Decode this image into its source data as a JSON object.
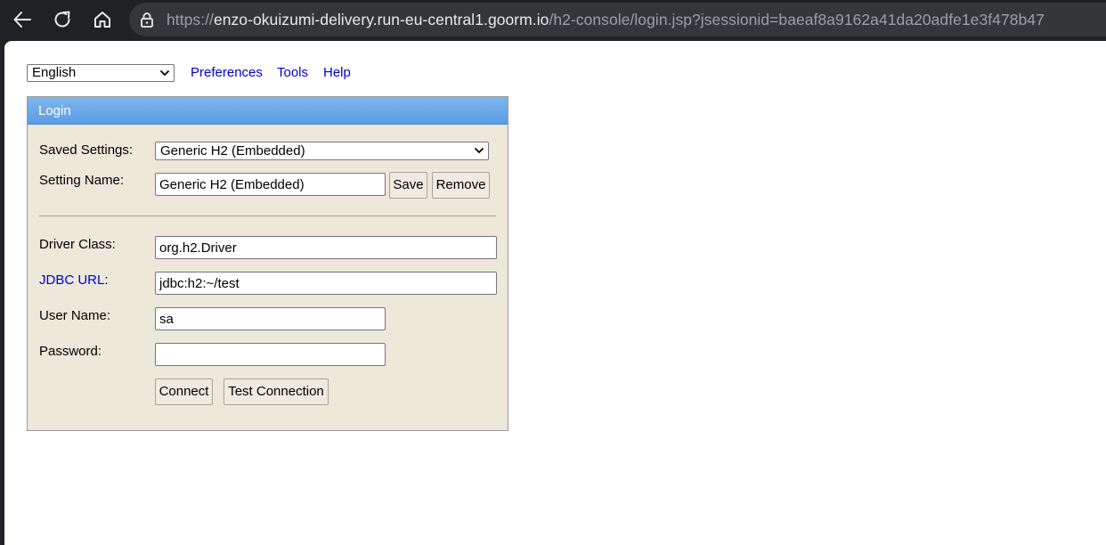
{
  "browser": {
    "url_scheme": "https://",
    "url_host": "enzo-okuizumi-delivery.run-eu-central1.goorm.io",
    "url_path": "/h2-console/login.jsp?jsessionid=baeaf8a9162a41da20adfe1e3f478b47",
    "icons": [
      "back-icon",
      "reload-icon",
      "home-icon",
      "lock-icon"
    ]
  },
  "toolbar": {
    "language": "English",
    "preferences": "Preferences",
    "tools": "Tools",
    "help": "Help"
  },
  "login": {
    "title": "Login",
    "saved_settings_label": "Saved Settings:",
    "saved_settings_value": "Generic H2 (Embedded)",
    "setting_name_label": "Setting Name:",
    "setting_name_value": "Generic H2 (Embedded)",
    "save_button": "Save",
    "remove_button": "Remove",
    "driver_class_label": "Driver Class:",
    "driver_class_value": "org.h2.Driver",
    "jdbc_url_label": "JDBC URL",
    "jdbc_url_colon": ":",
    "jdbc_url_value": "jdbc:h2:~/test",
    "user_name_label": "User Name:",
    "user_name_value": "sa",
    "password_label": "Password:",
    "password_value": "",
    "connect_button": "Connect",
    "test_connection_button": "Test Connection"
  },
  "colors": {
    "panel_background": "#ece8da",
    "panel_header": "#6aa8eb",
    "link": "#0000cc",
    "browser_chrome": "#202124"
  }
}
